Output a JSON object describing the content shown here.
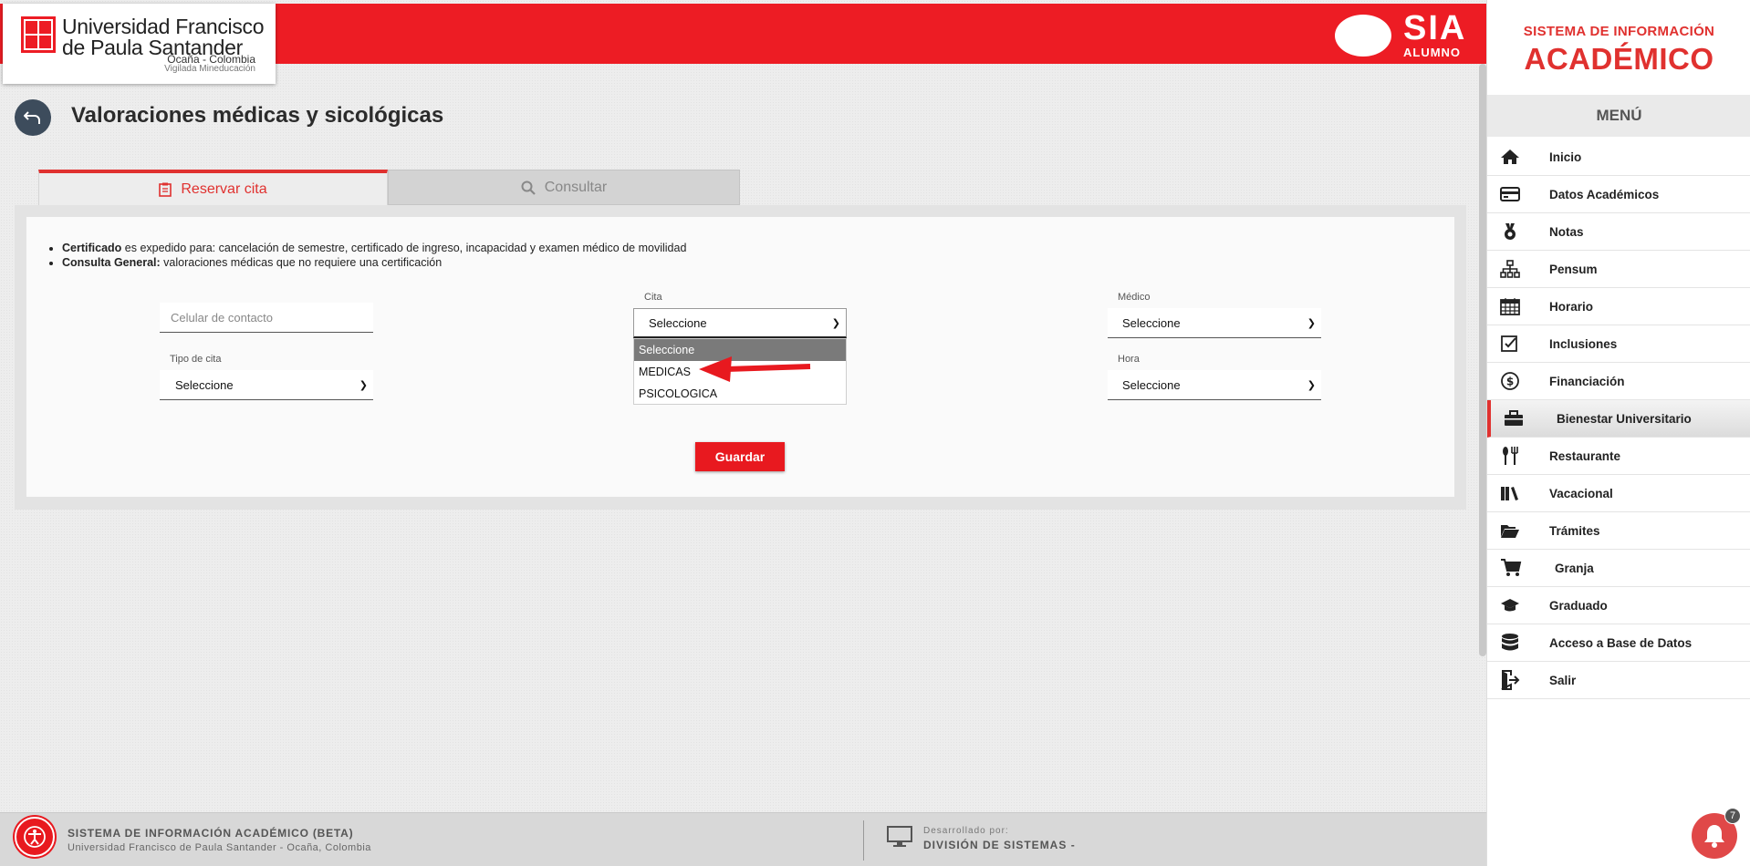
{
  "header": {
    "university_line1": "Universidad Francisco",
    "university_line2": "de Paula Santander",
    "location": "Ocaña - Colombia",
    "vigilada": "Vigilada Mineducación",
    "sia": "SIA",
    "sia_sub": "ALUMNO"
  },
  "page": {
    "title": "Valoraciones médicas y sicológicas"
  },
  "tabs": [
    {
      "label": "Reservar cita",
      "icon": "clipboard-icon",
      "active": true
    },
    {
      "label": "Consultar",
      "icon": "search-icon",
      "active": false
    }
  ],
  "info": [
    {
      "bold": "Certificado",
      "text": " es expedido para: cancelación de semestre, certificado de ingreso, incapacidad y examen médico de movilidad"
    },
    {
      "bold": "Consulta General:",
      "text": " valoraciones médicas que no requiere una certificación"
    }
  ],
  "form": {
    "celular_placeholder": "Celular de contacto",
    "cita_label": "Cita",
    "cita_value": "Seleccione",
    "medico_label": "Médico",
    "medico_value": "Seleccione",
    "tipo_label": "Tipo de cita",
    "tipo_value": "Seleccione",
    "hora_label": "Hora",
    "hora_value": "Seleccione",
    "cita_options": [
      "Seleccione",
      "MEDICAS",
      "PSICOLOGICA"
    ],
    "save_label": "Guardar"
  },
  "sidebar": {
    "brand_line1": "SISTEMA DE INFORMACIÓN",
    "brand_line2": "ACADÉMICO",
    "menu_title": "MENÚ",
    "items": [
      {
        "label": "Inicio",
        "icon": "home-icon"
      },
      {
        "label": "Datos Académicos",
        "icon": "id-card-icon"
      },
      {
        "label": "Notas",
        "icon": "medal-icon"
      },
      {
        "label": "Pensum",
        "icon": "sitemap-icon"
      },
      {
        "label": "Horario",
        "icon": "calendar-icon"
      },
      {
        "label": "Inclusiones",
        "icon": "check-square-icon"
      },
      {
        "label": "Financiación",
        "icon": "dollar-icon"
      },
      {
        "label": "Bienestar Universitario",
        "icon": "briefcase-icon",
        "active": true
      },
      {
        "label": "Restaurante",
        "icon": "utensils-icon"
      },
      {
        "label": "Vacacional",
        "icon": "books-icon"
      },
      {
        "label": "Trámites",
        "icon": "folder-open-icon"
      },
      {
        "label": "Granja",
        "icon": "cart-icon"
      },
      {
        "label": "Graduado",
        "icon": "graduation-cap-icon"
      },
      {
        "label": "Acceso a Base de Datos",
        "icon": "database-icon"
      },
      {
        "label": "Salir",
        "icon": "sign-out-icon"
      }
    ]
  },
  "footer": {
    "line1": "SISTEMA DE INFORMACIÓN ACADÉMICO (BETA)",
    "line2": "Universidad Francisco de Paula Santander - Ocaña, Colombia",
    "dev_label": "Desarrollado por:",
    "dev_name": "DIVISIÓN DE SISTEMAS -"
  },
  "notifications": {
    "count": "7"
  },
  "colors": {
    "brand_red": "#ed1c24",
    "dark_blue": "#3d4c5c"
  }
}
